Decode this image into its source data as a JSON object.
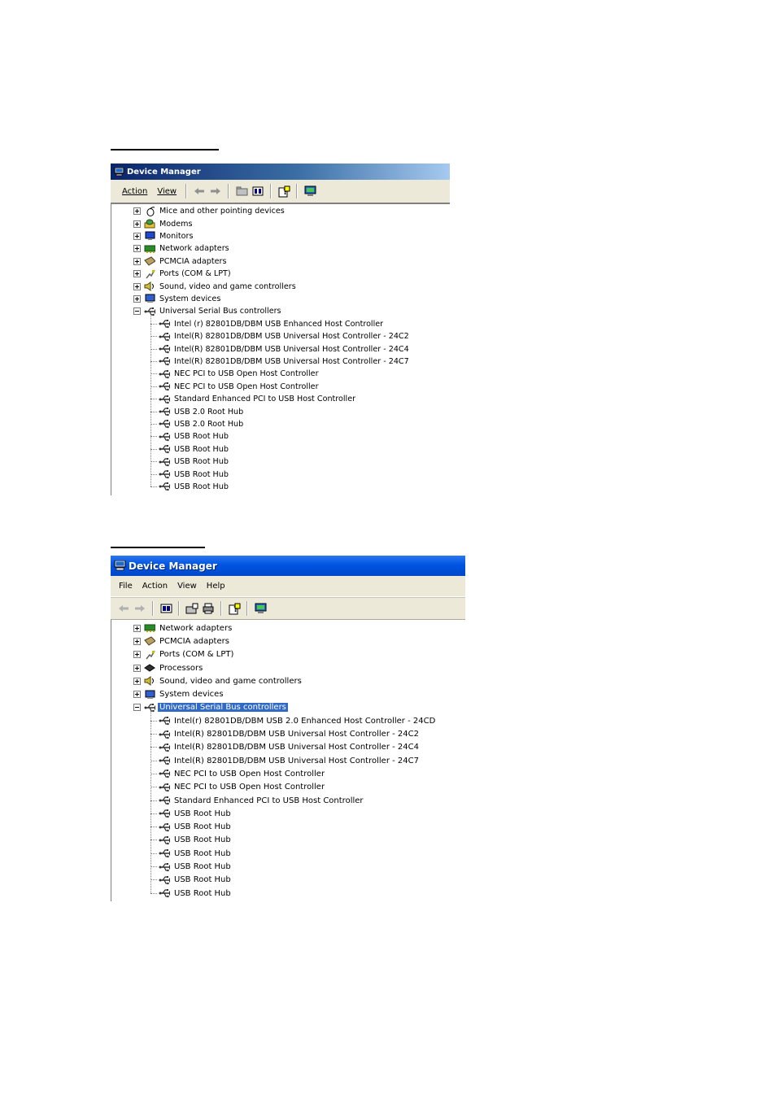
{
  "win1": {
    "title": "Device Manager",
    "menu": [
      "Action",
      "View"
    ],
    "categories": [
      {
        "label": "Mice and other pointing devices",
        "icon": "mouse-icon"
      },
      {
        "label": "Modems",
        "icon": "modem-icon"
      },
      {
        "label": "Monitors",
        "icon": "monitor-icon"
      },
      {
        "label": "Network adapters",
        "icon": "network-adapter-icon"
      },
      {
        "label": "PCMCIA adapters",
        "icon": "pcmcia-icon"
      },
      {
        "label": "Ports (COM & LPT)",
        "icon": "port-icon"
      },
      {
        "label": "Sound, video and game controllers",
        "icon": "sound-icon"
      },
      {
        "label": "System devices",
        "icon": "system-device-icon"
      },
      {
        "label": "Universal Serial Bus controllers",
        "icon": "usb-icon",
        "expanded": true
      }
    ],
    "children": [
      "Intel (r) 82801DB/DBM USB Enhanced Host Controller",
      "Intel(R) 82801DB/DBM USB Universal Host Controller - 24C2",
      "Intel(R) 82801DB/DBM USB Universal Host Controller - 24C4",
      "Intel(R) 82801DB/DBM USB Universal Host Controller - 24C7",
      "NEC PCI to USB Open Host Controller",
      "NEC PCI to USB Open Host Controller",
      "Standard Enhanced PCI to USB Host Controller",
      "USB 2.0 Root Hub",
      "USB 2.0 Root Hub",
      "USB Root Hub",
      "USB Root Hub",
      "USB Root Hub",
      "USB Root Hub",
      "USB Root Hub"
    ]
  },
  "win2": {
    "title": "Device Manager",
    "menu": [
      "File",
      "Action",
      "View",
      "Help"
    ],
    "categories": [
      {
        "label": "Network adapters",
        "icon": "network-adapter-icon"
      },
      {
        "label": "PCMCIA adapters",
        "icon": "pcmcia-icon"
      },
      {
        "label": "Ports (COM & LPT)",
        "icon": "port-icon"
      },
      {
        "label": "Processors",
        "icon": "processor-icon"
      },
      {
        "label": "Sound, video and game controllers",
        "icon": "sound-icon"
      },
      {
        "label": "System devices",
        "icon": "system-device-icon"
      },
      {
        "label": "Universal Serial Bus controllers",
        "icon": "usb-icon",
        "expanded": true,
        "selected": true
      }
    ],
    "children": [
      "Intel(r) 82801DB/DBM USB 2.0 Enhanced Host Controller - 24CD",
      "Intel(R) 82801DB/DBM USB Universal Host Controller - 24C2",
      "Intel(R) 82801DB/DBM USB Universal Host Controller - 24C4",
      "Intel(R) 82801DB/DBM USB Universal Host Controller - 24C7",
      "NEC PCI to USB Open Host Controller",
      "NEC PCI to USB Open Host Controller",
      "Standard Enhanced PCI to USB Host Controller",
      "USB Root Hub",
      "USB Root Hub",
      "USB Root Hub",
      "USB Root Hub",
      "USB Root Hub",
      "USB Root Hub",
      "USB Root Hub"
    ]
  },
  "colors": {
    "title_classic": "#0a246a",
    "title_classic_end": "#a6caf0",
    "title_xp": "#0054e3",
    "selection": "#316ac5"
  }
}
